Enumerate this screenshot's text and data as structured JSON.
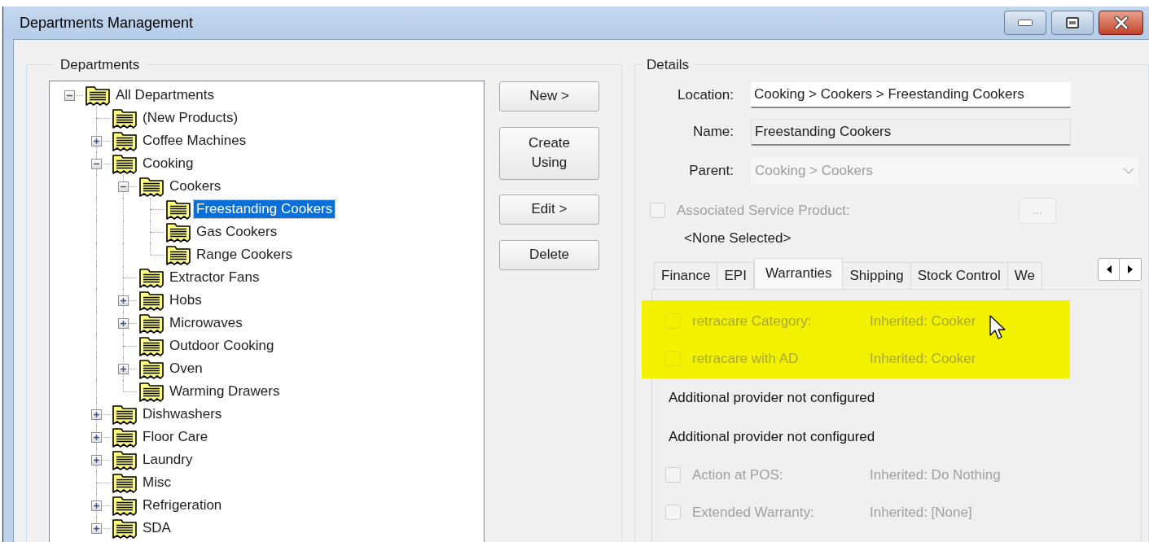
{
  "window": {
    "title": "Departments Management"
  },
  "departments": {
    "title": "Departments",
    "tree": [
      {
        "label": "All Departments",
        "kind": "branch",
        "expanded": true,
        "selected": false,
        "children": [
          {
            "label": "(New Products)",
            "kind": "leaf",
            "selected": false
          },
          {
            "label": "Coffee Machines",
            "kind": "branch",
            "expanded": false,
            "selected": false
          },
          {
            "label": "Cooking",
            "kind": "branch",
            "expanded": true,
            "selected": false,
            "children": [
              {
                "label": "Cookers",
                "kind": "branch",
                "expanded": true,
                "selected": false,
                "children": [
                  {
                    "label": "Freestanding Cookers",
                    "kind": "leaf",
                    "selected": true
                  },
                  {
                    "label": "Gas Cookers",
                    "kind": "leaf",
                    "selected": false
                  },
                  {
                    "label": "Range Cookers",
                    "kind": "leaf",
                    "selected": false
                  }
                ]
              },
              {
                "label": "Extractor Fans",
                "kind": "leaf",
                "selected": false
              },
              {
                "label": "Hobs",
                "kind": "branch",
                "expanded": false,
                "selected": false
              },
              {
                "label": "Microwaves",
                "kind": "branch",
                "expanded": false,
                "selected": false
              },
              {
                "label": "Outdoor Cooking",
                "kind": "leaf",
                "selected": false
              },
              {
                "label": "Oven",
                "kind": "branch",
                "expanded": false,
                "selected": false
              },
              {
                "label": "Warming Drawers",
                "kind": "leaf",
                "selected": false
              }
            ]
          },
          {
            "label": "Dishwashers",
            "kind": "branch",
            "expanded": false,
            "selected": false
          },
          {
            "label": "Floor Care",
            "kind": "branch",
            "expanded": false,
            "selected": false
          },
          {
            "label": "Laundry",
            "kind": "branch",
            "expanded": false,
            "selected": false
          },
          {
            "label": "Misc",
            "kind": "leaf",
            "selected": false
          },
          {
            "label": "Refrigeration",
            "kind": "branch",
            "expanded": false,
            "selected": false
          },
          {
            "label": "SDA",
            "kind": "branch",
            "expanded": false,
            "selected": false
          }
        ]
      }
    ],
    "buttons": [
      {
        "label": "New >",
        "kind": "single"
      },
      {
        "label": "Create Using",
        "kind": "double"
      },
      {
        "label": "Edit >",
        "kind": "single"
      },
      {
        "label": "Delete",
        "kind": "single"
      }
    ]
  },
  "details": {
    "title": "Details",
    "fields": [
      {
        "label": "Location:",
        "value": "Cooking > Cookers > Freestanding Cookers",
        "kind": "text"
      },
      {
        "label": "Name:",
        "value": "Freestanding Cookers",
        "kind": "readonly"
      },
      {
        "label": "Parent:",
        "value": "Cooking > Cookers",
        "kind": "combo",
        "disabled": true
      }
    ],
    "service_product": {
      "label": "Associated Service Product:",
      "checked": false,
      "disabled": true,
      "browse_button": "...",
      "selection": "<None Selected>"
    },
    "tabs": [
      {
        "label": "Finance",
        "selected": false
      },
      {
        "label": "EPI",
        "selected": false
      },
      {
        "label": "Warranties",
        "selected": true
      },
      {
        "label": "Shipping",
        "selected": false
      },
      {
        "label": "Stock Control",
        "selected": false
      },
      {
        "label": "We",
        "selected": false
      }
    ],
    "warranty_items": [
      {
        "kind": "option",
        "label": "retracare Category:",
        "value": "Inherited: Cooker",
        "checked": false,
        "disabled": true,
        "highlighted": true
      },
      {
        "kind": "option",
        "label": "retracare with AD",
        "value": "Inherited: Cooker",
        "checked": false,
        "disabled": true,
        "highlighted": true
      },
      {
        "kind": "note",
        "label": "Additional provider not configured",
        "highlighted": false
      },
      {
        "kind": "note",
        "label": "Additional provider not configured",
        "highlighted": false
      },
      {
        "kind": "option",
        "label": "Action at POS:",
        "value": "Inherited: Do Nothing",
        "checked": false,
        "disabled": true,
        "highlighted": false
      },
      {
        "kind": "option",
        "label": "Extended Warranty:",
        "value": "Inherited: [None]",
        "checked": false,
        "disabled": true,
        "highlighted": false
      }
    ]
  }
}
